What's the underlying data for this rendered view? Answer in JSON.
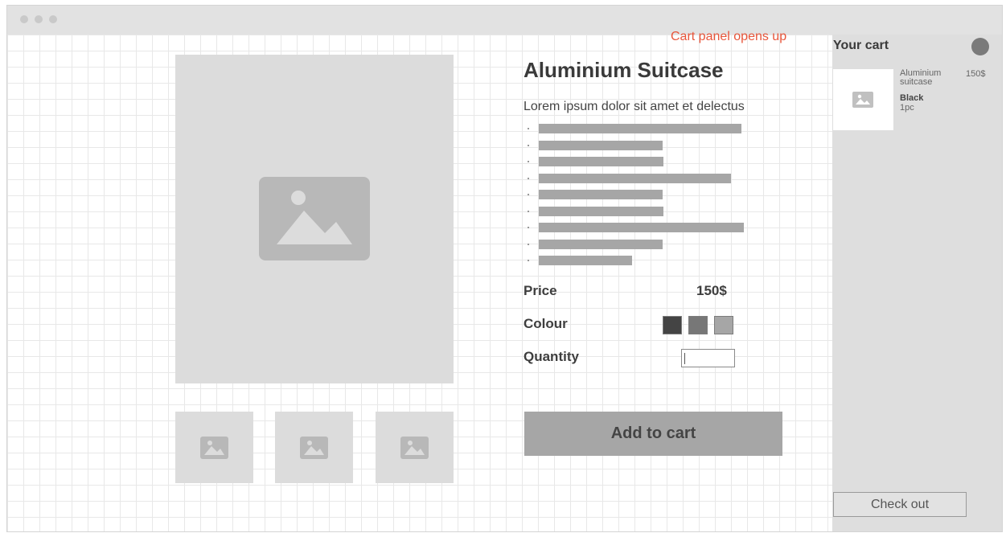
{
  "annotation": "Cart panel opens up",
  "product": {
    "title": "Aluminium Suitcase",
    "subtitle": "Lorem ipsum dolor sit amet et delectus",
    "price_label": "Price",
    "price_value": "150$",
    "colour_label": "Colour",
    "quantity_label": "Quantity",
    "quantity_value": "",
    "add_to_cart_label": "Add to cart",
    "colour_swatches": [
      "#444444",
      "#777777",
      "#a6a6a6"
    ]
  },
  "cart": {
    "title": "Your cart",
    "item": {
      "name": "Aluminium suitcase",
      "colour": "Black",
      "quantity": "1pc",
      "price": "150$"
    },
    "checkout_label": "Check out"
  },
  "icons": {
    "image_placeholder": "image-placeholder-icon",
    "close": "close-icon"
  }
}
